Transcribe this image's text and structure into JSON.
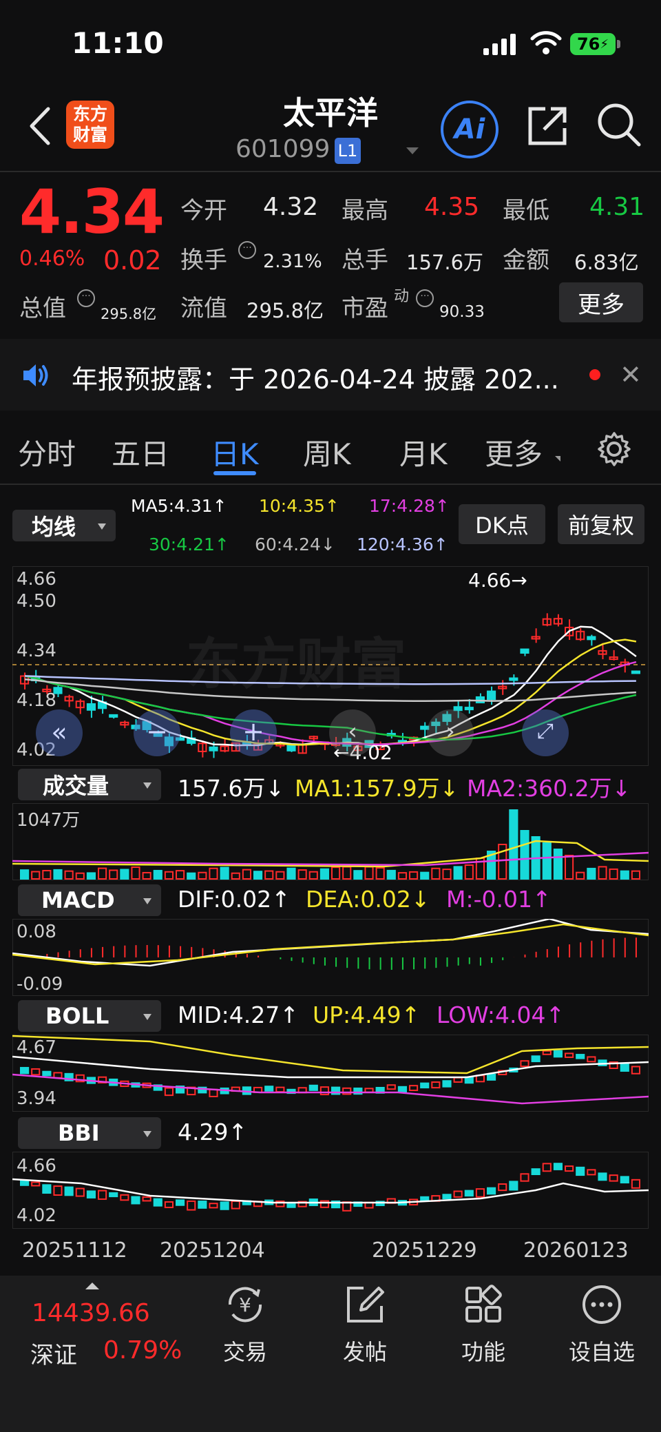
{
  "status": {
    "time": "11:10",
    "battery": "76"
  },
  "header": {
    "logo_line1": "东方",
    "logo_line2": "财富",
    "name": "太平洋",
    "code": "601099",
    "badge": "L1",
    "ai": "Ai"
  },
  "quote": {
    "price": "4.34",
    "change_pct": "0.46%",
    "change": "0.02",
    "open_label": "今开",
    "open": "4.32",
    "high_label": "最高",
    "high": "4.35",
    "low_label": "最低",
    "low": "4.31",
    "turnover_label": "换手",
    "turnover": "2.31%",
    "volume_label": "总手",
    "volume": "157.6万",
    "amount_label": "金额",
    "amount": "6.83亿",
    "mktcap_label": "总值",
    "mktcap": "295.8亿",
    "float_label": "流值",
    "float": "295.8亿",
    "pe_label": "市盈",
    "pe_sup": "动",
    "pe": "90.33",
    "more": "更多"
  },
  "notice": {
    "text": "年报预披露：于 2026-04-24 披露 202..."
  },
  "tabs": [
    "分时",
    "五日",
    "日K",
    "周K",
    "月K",
    "更多"
  ],
  "active_tab": "日K",
  "ma": {
    "selector": "均线",
    "ma5": "MA5:4.31↑",
    "ma10": "10:4.35↑",
    "ma17": "17:4.28↑",
    "ma30": "30:4.21↑",
    "ma60": "60:4.24↓",
    "ma120": "120:4.36↑",
    "dk": "DK点",
    "fq": "前复权"
  },
  "kline": {
    "y_high": "4.66",
    "y_450": "4.50",
    "y_434": "4.34",
    "y_418": "4.18",
    "y_low": "4.02",
    "max_mark": "4.66→",
    "min_mark": "←4.02"
  },
  "volume": {
    "selector": "成交量",
    "v": "157.6万↓",
    "ma1": "MA1:157.9万↓",
    "ma2": "MA2:360.2万↓",
    "y_max": "1047万"
  },
  "macd": {
    "selector": "MACD",
    "dif": "DIF:0.02↑",
    "dea": "DEA:0.02↓",
    "m": "M:-0.01↑",
    "y_high": "0.08",
    "y_low": "-0.09"
  },
  "boll": {
    "selector": "BOLL",
    "mid": "MID:4.27↑",
    "up": "UP:4.49↑",
    "low": "LOW:4.04↑",
    "y_high": "4.67",
    "y_low": "3.94"
  },
  "bbi": {
    "selector": "BBI",
    "value": "4.29↑",
    "y_high": "4.66",
    "y_low": "4.02"
  },
  "dates": [
    "20251112",
    "20251204",
    "20251229",
    "20260123"
  ],
  "bottom": {
    "index_value": "14439.66",
    "index_name": "深证",
    "index_pct": "0.79%",
    "trade": "交易",
    "post": "发帖",
    "func": "功能",
    "watch": "设自选"
  },
  "colors": {
    "up": "#ff2b2b",
    "down": "#17d9d9",
    "accent": "#3f8cff"
  }
}
